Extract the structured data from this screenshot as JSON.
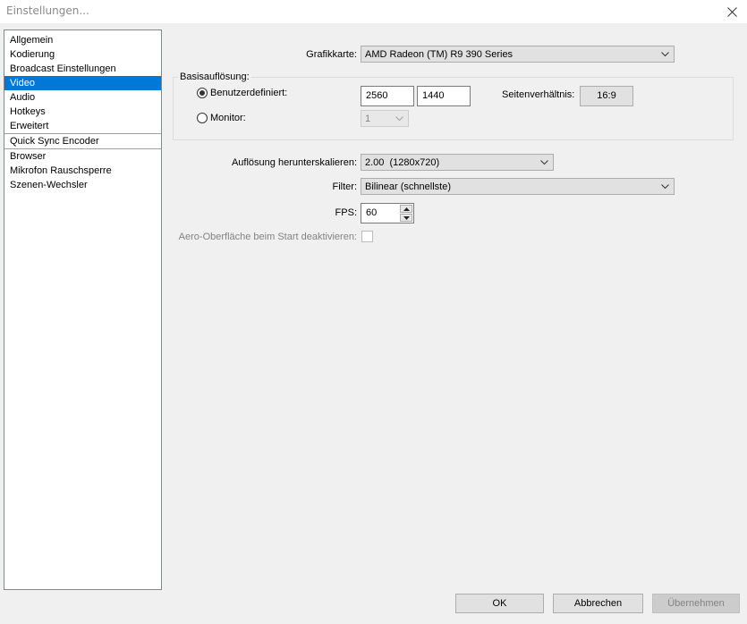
{
  "window": {
    "title": "Einstellungen..."
  },
  "sidebar": {
    "items": [
      {
        "label": "Allgemein"
      },
      {
        "label": "Kodierung"
      },
      {
        "label": "Broadcast Einstellungen"
      },
      {
        "label": "Video",
        "selected": true
      },
      {
        "label": "Audio"
      },
      {
        "label": "Hotkeys"
      },
      {
        "label": "Erweitert"
      },
      {
        "label": "Quick Sync Encoder"
      },
      {
        "label": "Browser"
      },
      {
        "label": "Mikrofon Rauschsperre"
      },
      {
        "label": "Szenen-Wechsler"
      }
    ]
  },
  "video": {
    "graphics_card_label": "Grafikkarte:",
    "graphics_card_value": "AMD Radeon (TM) R9 390 Series",
    "base_resolution": {
      "title": "Basisauflösung:",
      "custom_label": "Benutzerdefiniert:",
      "custom_selected": true,
      "width": "2560",
      "height": "1440",
      "aspect_label": "Seitenverhältnis:",
      "aspect_value": "16:9",
      "monitor_label": "Monitor:",
      "monitor_value": "1"
    },
    "downscale_label": "Auflösung herunterskalieren:",
    "downscale_value": "2.00  (1280x720)",
    "filter_label": "Filter:",
    "filter_value": "Bilinear (schnellste)",
    "fps_label": "FPS:",
    "fps_value": "60",
    "aero_label": "Aero-Oberfläche beim Start deaktivieren:",
    "aero_checked": false
  },
  "buttons": {
    "ok": "OK",
    "cancel": "Abbrechen",
    "apply": "Übernehmen"
  },
  "colors": {
    "selection": "#0078d7",
    "window_bg": "#f0f0f0"
  }
}
